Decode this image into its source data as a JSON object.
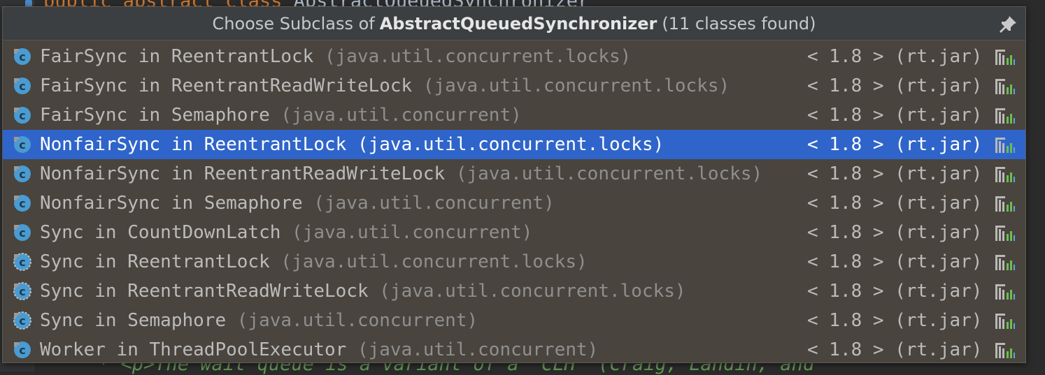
{
  "editor": {
    "top_line_keywords": "public abstract class ",
    "top_line_name": "AbstractQueuedSynchronizer",
    "bottom_line": "* <p>The wait queue is a variant of a \"CLH\" (Craig, Landin, and"
  },
  "popup": {
    "title_prefix": "Choose Subclass of",
    "title_class": "AbstractQueuedSynchronizer",
    "title_suffix": "(11 classes found)",
    "pin_icon": "pin-icon",
    "items": [
      {
        "name": "FairSync in ReentrantLock",
        "pkg": "(java.util.concurrent.locks)",
        "version": "< 1.8 > (rt.jar)",
        "selected": false,
        "icon": "class-icon"
      },
      {
        "name": "FairSync in ReentrantReadWriteLock",
        "pkg": "(java.util.concurrent.locks)",
        "version": "< 1.8 > (rt.jar)",
        "selected": false,
        "icon": "class-icon"
      },
      {
        "name": "FairSync in Semaphore",
        "pkg": "(java.util.concurrent)",
        "version": "< 1.8 > (rt.jar)",
        "selected": false,
        "icon": "class-icon"
      },
      {
        "name": "NonfairSync in ReentrantLock",
        "pkg": "(java.util.concurrent.locks)",
        "version": "< 1.8 > (rt.jar)",
        "selected": true,
        "icon": "class-icon"
      },
      {
        "name": "NonfairSync in ReentrantReadWriteLock",
        "pkg": "(java.util.concurrent.locks)",
        "version": "< 1.8 > (rt.jar)",
        "selected": false,
        "icon": "class-icon"
      },
      {
        "name": "NonfairSync in Semaphore",
        "pkg": "(java.util.concurrent)",
        "version": "< 1.8 > (rt.jar)",
        "selected": false,
        "icon": "class-icon"
      },
      {
        "name": "Sync in CountDownLatch",
        "pkg": "(java.util.concurrent)",
        "version": "< 1.8 > (rt.jar)",
        "selected": false,
        "icon": "class-icon"
      },
      {
        "name": "Sync in ReentrantLock",
        "pkg": "(java.util.concurrent.locks)",
        "version": "< 1.8 > (rt.jar)",
        "selected": false,
        "icon": "abstract-class-icon"
      },
      {
        "name": "Sync in ReentrantReadWriteLock",
        "pkg": "(java.util.concurrent.locks)",
        "version": "< 1.8 > (rt.jar)",
        "selected": false,
        "icon": "abstract-class-icon"
      },
      {
        "name": "Sync in Semaphore",
        "pkg": "(java.util.concurrent)",
        "version": "< 1.8 > (rt.jar)",
        "selected": false,
        "icon": "abstract-class-icon"
      },
      {
        "name": "Worker in ThreadPoolExecutor",
        "pkg": "(java.util.concurrent)",
        "version": "< 1.8 > (rt.jar)",
        "selected": false,
        "icon": "class-icon"
      }
    ]
  },
  "colors": {
    "selection": "#2f65ca",
    "class_icon": "#4a9bd1",
    "library_icon_bar": "#6bbf4f"
  }
}
